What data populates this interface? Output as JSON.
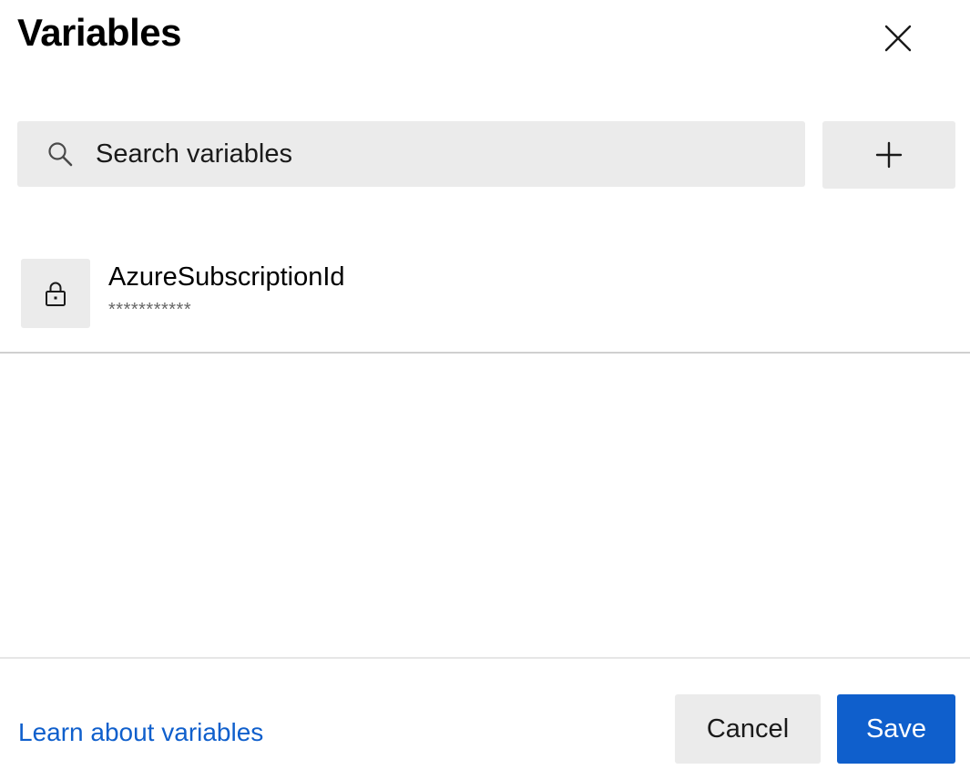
{
  "dialog": {
    "title": "Variables"
  },
  "icons": {
    "close": "close-icon",
    "search": "search-icon",
    "add": "plus-icon",
    "lock": "lock-icon"
  },
  "search": {
    "placeholder": "Search variables",
    "value": ""
  },
  "variables": [
    {
      "name": "AzureSubscriptionId",
      "value": "***********",
      "secret": true
    }
  ],
  "footer": {
    "learn_link": "Learn about variables",
    "cancel_label": "Cancel",
    "save_label": "Save"
  },
  "colors": {
    "accent": "#0f5fcc",
    "control_bg": "#ebebeb",
    "muted_text": "#666666"
  }
}
